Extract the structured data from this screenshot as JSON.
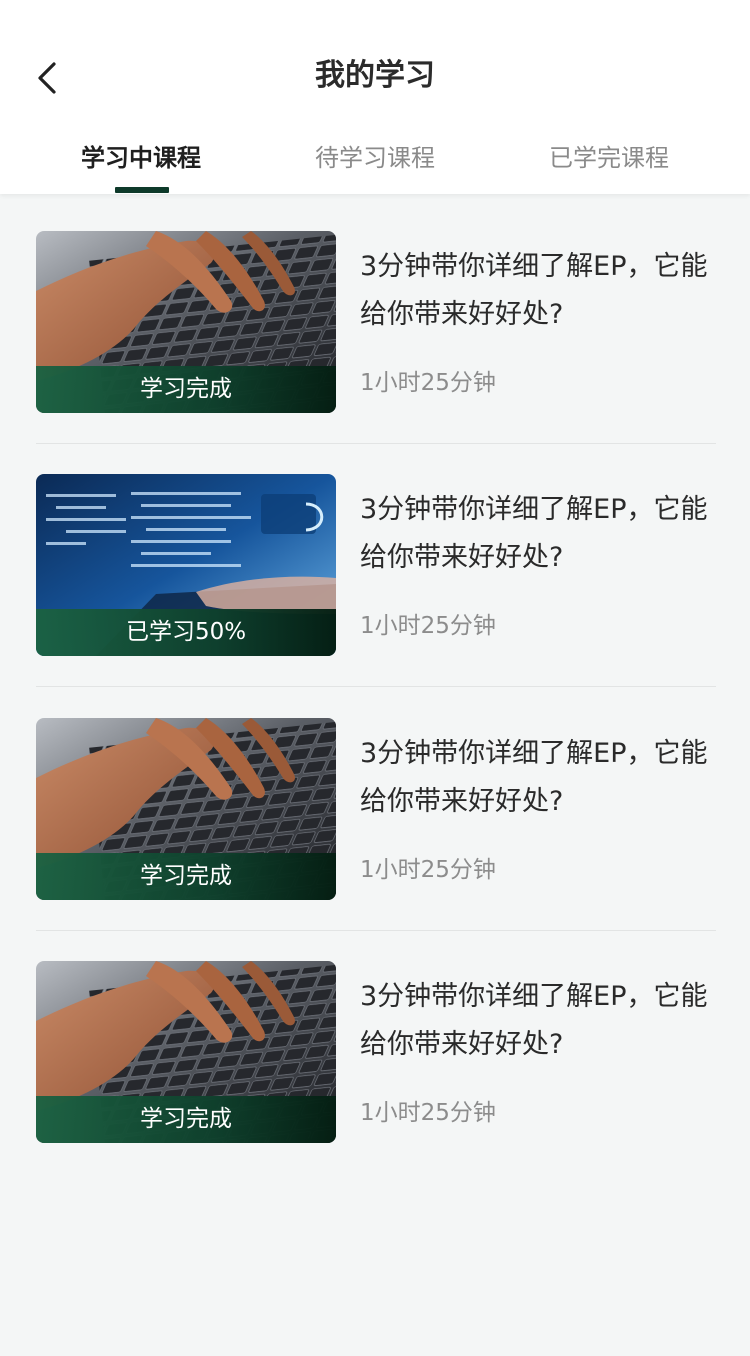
{
  "header": {
    "title": "我的学习",
    "back_icon": "chevron-left-icon"
  },
  "tabs": [
    {
      "label": "学习中课程",
      "active": true
    },
    {
      "label": "待学习课程",
      "active": false
    },
    {
      "label": "已学完课程",
      "active": false
    }
  ],
  "colors": {
    "accent": "#0e3a2a",
    "badge_start": "#1b6242",
    "badge_end": "#041e12"
  },
  "courses": [
    {
      "thumbnail": "keyboard-typing-image",
      "badge": "学习完成",
      "title": "3分钟带你详细了解EP，它能给你带来好好处?",
      "duration": "1小时25分钟"
    },
    {
      "thumbnail": "laptop-code-image",
      "badge": "已学习50%",
      "progress": 0.5,
      "title": "3分钟带你详细了解EP，它能给你带来好好处?",
      "duration": "1小时25分钟"
    },
    {
      "thumbnail": "keyboard-typing-image",
      "badge": "学习完成",
      "title": "3分钟带你详细了解EP，它能给你带来好好处?",
      "duration": "1小时25分钟"
    },
    {
      "thumbnail": "keyboard-typing-image",
      "badge": "学习完成",
      "title": "3分钟带你详细了解EP，它能给你带来好好处?",
      "duration": "1小时25分钟"
    }
  ]
}
